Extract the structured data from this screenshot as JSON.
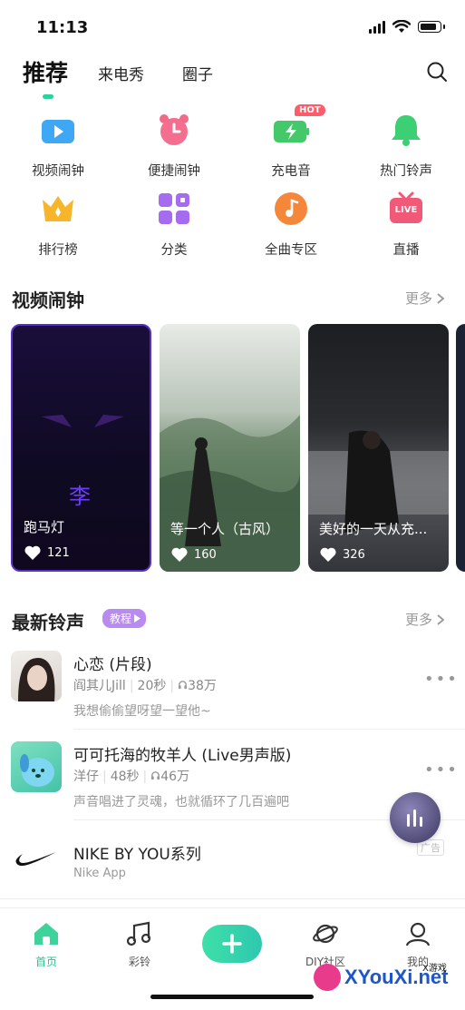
{
  "status": {
    "time": "11:13"
  },
  "tabs": [
    {
      "label": "推荐",
      "active": true
    },
    {
      "label": "来电秀",
      "active": false
    },
    {
      "label": "圈子",
      "active": false
    }
  ],
  "grid": [
    {
      "label": "视频闹钟",
      "icon": "video-camera-icon"
    },
    {
      "label": "便捷闹钟",
      "icon": "alarm-clock-icon"
    },
    {
      "label": "充电音",
      "icon": "charging-battery-icon",
      "badge": "HOT"
    },
    {
      "label": "热门铃声",
      "icon": "bell-icon"
    },
    {
      "label": "排行榜",
      "icon": "crown-icon"
    },
    {
      "label": "分类",
      "icon": "category-grid-icon"
    },
    {
      "label": "全曲专区",
      "icon": "music-note-icon"
    },
    {
      "label": "直播",
      "icon": "live-tv-icon",
      "icon_text": "LIVE"
    }
  ],
  "video_section": {
    "title": "视频闹钟",
    "more": "更多",
    "cards": [
      {
        "title": "跑马灯",
        "likes": "121",
        "overlay_char": "李"
      },
      {
        "title": "等一个人（古风）",
        "likes": "160"
      },
      {
        "title": "美好的一天从充...",
        "likes": "326"
      }
    ]
  },
  "ringtone_section": {
    "title": "最新铃声",
    "badge": "教程",
    "more": "更多",
    "songs": [
      {
        "title": "心恋 (片段)",
        "artist": "阎其儿Jill",
        "duration": "20秒",
        "plays": "38万",
        "desc": "我想偷偷望呀望一望他~"
      },
      {
        "title": "可可托海的牧羊人 (Live男声版)",
        "artist": "洋仔",
        "duration": "48秒",
        "plays": "46万",
        "desc": "声音唱进了灵魂，也就循环了几百遍吧"
      }
    ],
    "ad": {
      "title": "NIKE BY YOU系列",
      "subtitle": "Nike App",
      "tag": "广告"
    }
  },
  "bottom_nav": [
    {
      "label": "首页",
      "icon": "home-icon",
      "active": true
    },
    {
      "label": "彩铃",
      "icon": "music-notes-icon",
      "active": false
    },
    {
      "label": "",
      "icon": "plus-icon",
      "active": false
    },
    {
      "label": "DIY社区",
      "icon": "planet-icon",
      "active": false
    },
    {
      "label": "我的",
      "icon": "user-icon",
      "active": false
    }
  ],
  "watermark": {
    "text": "XYouXi.net",
    "small": "X游戏"
  },
  "colors": {
    "accent": "#2fd19b",
    "badge_purple": "#b98af0"
  }
}
